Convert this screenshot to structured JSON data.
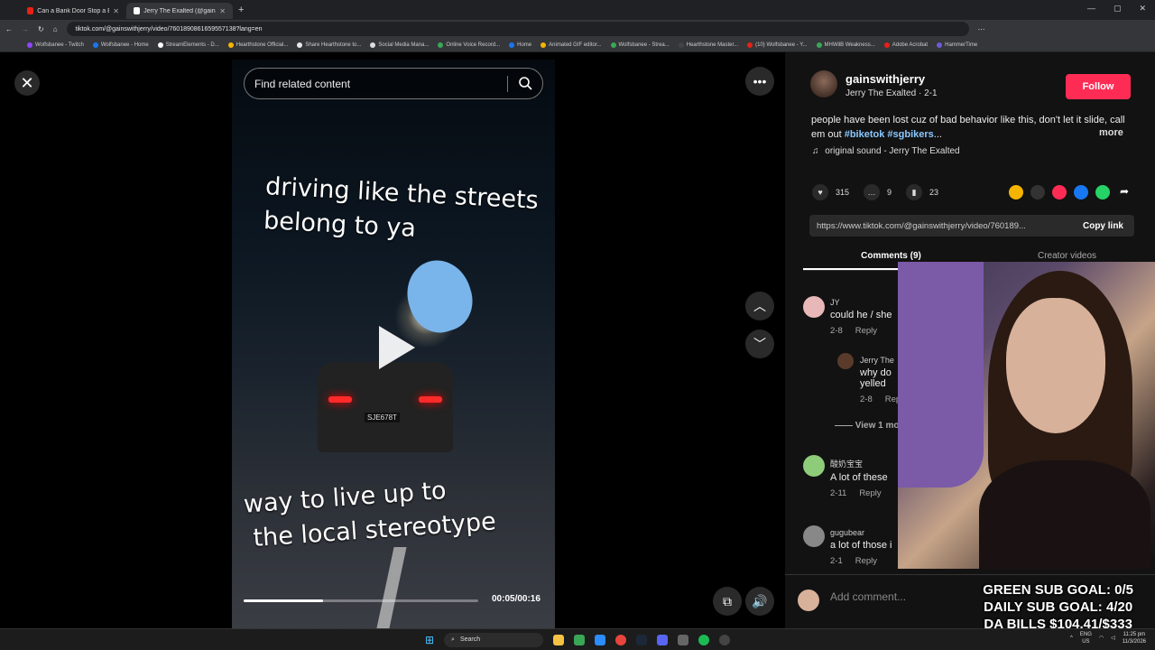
{
  "browser": {
    "tabs": [
      {
        "title": "Can a Bank Door Stop a Bullet?",
        "color": "#e62117"
      },
      {
        "title": "Jerry The Exalted (@gainswith...",
        "color": "#ffffff"
      }
    ],
    "url": "tiktok.com/@gainswithjerry/video/7601890861659557138?lang=en",
    "bookmarks": [
      "Wolfsbanee - Twitch",
      "Wolfsbanee - Home",
      "StreamElements - D...",
      "Hearthstone Official...",
      "Share Hearthstone to...",
      "Social Media Mana...",
      "Online Voice Record...",
      "Home",
      "Animated GIF editor...",
      "Wolfsbanee - Strea...",
      "Hearthstone Master...",
      "(10) Wolfsbanee - Y...",
      "MHWilB Weakness...",
      "Adobe Acrobat",
      "HammerTime"
    ]
  },
  "video": {
    "search_placeholder": "Find related content",
    "caption_top_1": "driving like the streets",
    "caption_top_2": "belong to ya",
    "caption_bottom_1": "way to live up to",
    "caption_bottom_2": "the local stereotype",
    "plate": "SJE678T",
    "time": "00:05/00:16",
    "progress": 0.34
  },
  "post": {
    "username": "gainswithjerry",
    "display": "Jerry The Exalted · 2-1",
    "follow_label": "Follow",
    "description": "people have been lost cuz of bad behavior like this, don't let it slide, call em out",
    "tag1": "#biketok",
    "tag2": "#sgbikers",
    "ellipsis": "...",
    "more_label": "more",
    "sound": "original sound - Jerry The Exalted",
    "likes": "315",
    "comments": "9",
    "saves": "23",
    "link": "https://www.tiktok.com/@gainswithjerry/video/760189...",
    "copy_label": "Copy link",
    "tab_comments": "Comments (9)",
    "tab_creator": "Creator videos"
  },
  "comments": [
    {
      "user": "JY",
      "text": "could he / she",
      "date": "2-8",
      "reply": "Reply"
    },
    {
      "user": "Jerry The",
      "text1": "why do",
      "text2": "yelled",
      "date": "2-8",
      "reply": "Rep"
    },
    {
      "view_more": "View 1 mo"
    },
    {
      "user": "酸奶宝宝",
      "text": "A lot of these",
      "date": "2-11",
      "reply": "Reply"
    },
    {
      "user": "gugubear",
      "text": "a lot of those i",
      "date": "2-1",
      "reply": "Reply"
    }
  ],
  "add_comment_placeholder": "Add comment...",
  "overlay": {
    "line1": "GREEN SUB GOAL: 0/5",
    "line2": "DAILY SUB GOAL: 4/20",
    "line3": "DA BILLS $104.41/$333"
  },
  "taskbar": {
    "search": "Search",
    "lang1": "ENG",
    "lang2": "US",
    "time": "11:25 pm",
    "date": "11/3/2026"
  }
}
